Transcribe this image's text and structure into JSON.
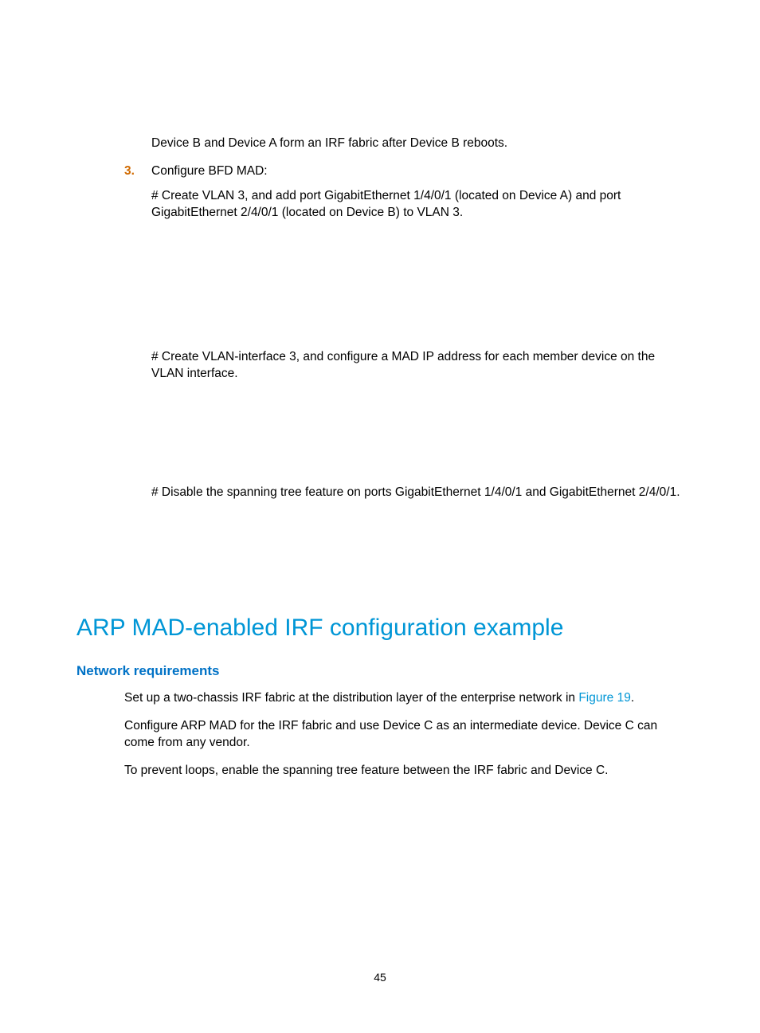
{
  "top_line": "Device B and Device A form an IRF fabric after Device B reboots.",
  "step3": {
    "num": "3.",
    "title": "Configure BFD MAD:",
    "p1": "# Create VLAN 3, and add port GigabitEthernet 1/4/0/1 (located on Device A) and port GigabitEthernet 2/4/0/1 (located on Device B) to VLAN 3.",
    "p2": "# Create VLAN-interface 3, and configure a MAD IP address for each member device on the VLAN interface.",
    "p3": "# Disable the spanning tree feature on ports GigabitEthernet 1/4/0/1 and GigabitEthernet 2/4/0/1."
  },
  "section_title": "ARP MAD-enabled IRF configuration example",
  "subsection_title": "Network requirements",
  "nr": {
    "p1a": "Set up a two-chassis IRF fabric at the distribution layer of the enterprise network in ",
    "p1_link": "Figure 19",
    "p1b": ".",
    "p2": "Configure ARP MAD for the IRF fabric and use Device C as an intermediate device. Device C can come from any vendor.",
    "p3": "To prevent loops, enable the spanning tree feature between the IRF fabric and Device C."
  },
  "page_number": "45"
}
